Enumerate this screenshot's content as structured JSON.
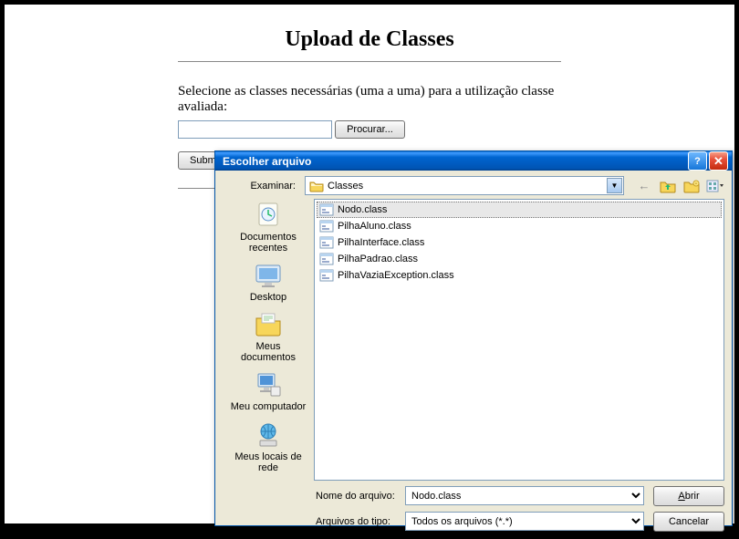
{
  "page": {
    "title": "Upload de Classes",
    "instruction": "Selecione as classes necessárias (uma a uma) para a utilização classe avaliada:",
    "file_input_value": "",
    "browse_label": "Procurar...",
    "submit_label": "Submeter"
  },
  "dialog": {
    "title": "Escolher arquivo",
    "look_in_label": "Examinar:",
    "look_in_value": "Classes",
    "nav": {
      "back": "←",
      "up": "↥",
      "new_folder": "✳",
      "views": "▦"
    },
    "places": [
      {
        "key": "recent",
        "label": "Documentos recentes"
      },
      {
        "key": "desktop",
        "label": "Desktop"
      },
      {
        "key": "mydocs",
        "label": "Meus documentos"
      },
      {
        "key": "mycomputer",
        "label": "Meu computador"
      },
      {
        "key": "network",
        "label": "Meus locais de rede"
      }
    ],
    "files": [
      {
        "name": "Nodo.class",
        "selected": true
      },
      {
        "name": "PilhaAluno.class",
        "selected": false
      },
      {
        "name": "PilhaInterface.class",
        "selected": false
      },
      {
        "name": "PilhaPadrao.class",
        "selected": false
      },
      {
        "name": "PilhaVaziaException.class",
        "selected": false
      }
    ],
    "filename_label": "Nome do arquivo:",
    "filename_value": "Nodo.class",
    "filetype_label": "Arquivos do tipo:",
    "filetype_value": "Todos os arquivos (*.*)",
    "open_label": "Abrir",
    "open_accel": "A",
    "cancel_label": "Cancelar"
  }
}
